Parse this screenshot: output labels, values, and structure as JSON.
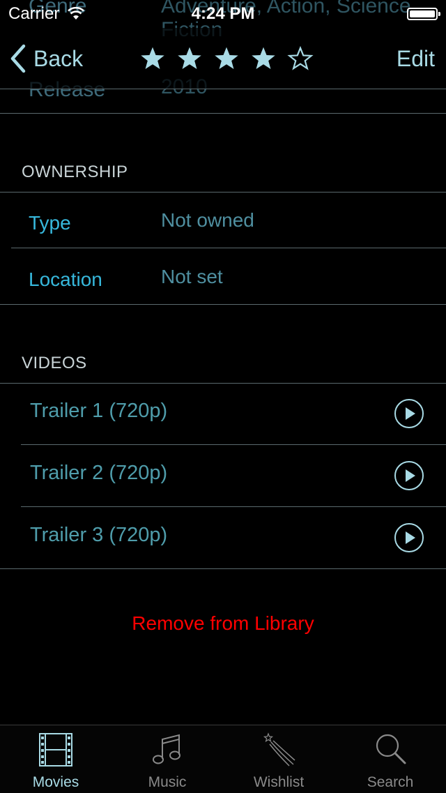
{
  "status": {
    "carrier": "Carrier",
    "time": "4:24 PM"
  },
  "ghost": {
    "genre_label": "Genre",
    "genre_value_line1": "Adventure, Action, Science",
    "genre_value_line2": "Fiction",
    "release_label": "Release",
    "release_value": "2010"
  },
  "nav": {
    "back_label": "Back",
    "edit_label": "Edit",
    "rating": 4,
    "rating_max": 5
  },
  "ownership": {
    "header": "OWNERSHIP",
    "rows": [
      {
        "label": "Type",
        "value": "Not owned"
      },
      {
        "label": "Location",
        "value": "Not set"
      }
    ]
  },
  "videos": {
    "header": "VIDEOS",
    "items": [
      {
        "label": "Trailer 1 (720p)"
      },
      {
        "label": "Trailer 2 (720p)"
      },
      {
        "label": "Trailer 3 (720p)"
      }
    ]
  },
  "remove_label": "Remove from Library",
  "tabs": [
    {
      "label": "Movies",
      "icon": "film-icon",
      "active": true
    },
    {
      "label": "Music",
      "icon": "music-note-icon",
      "active": false
    },
    {
      "label": "Wishlist",
      "icon": "shooting-star-icon",
      "active": false
    },
    {
      "label": "Search",
      "icon": "search-icon",
      "active": false
    }
  ],
  "colors": {
    "accent": "#a9dbe6",
    "label": "#37b8dc",
    "value": "#4f8fa0",
    "destructive": "#ff0000"
  }
}
